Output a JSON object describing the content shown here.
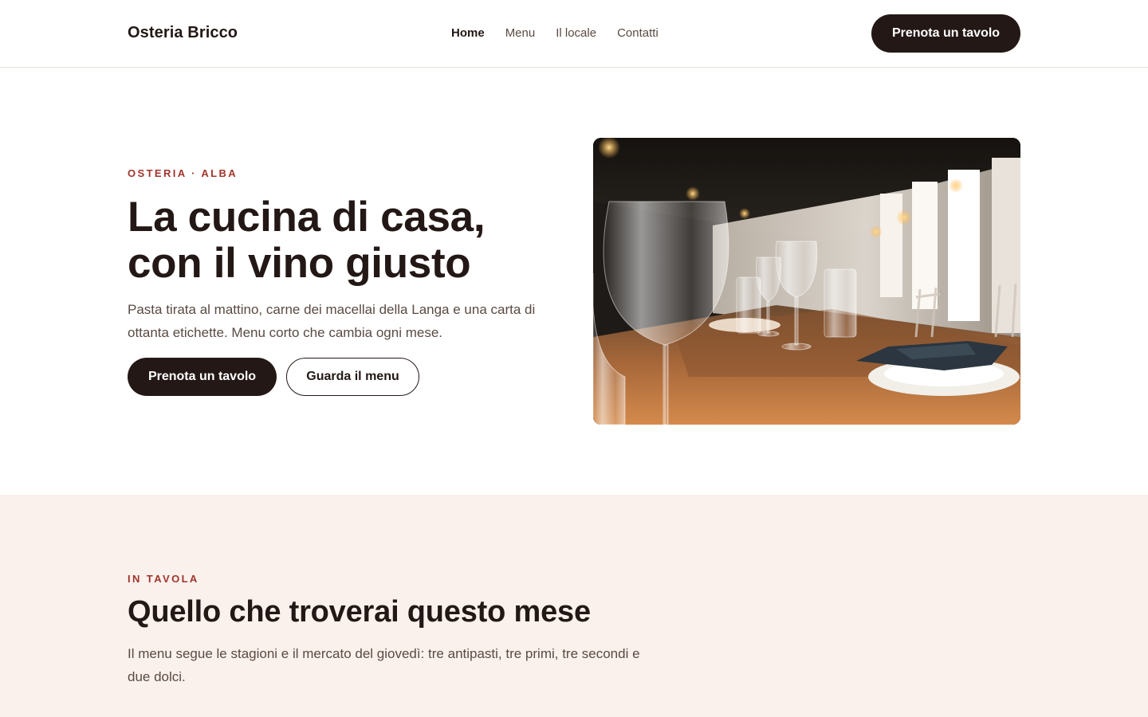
{
  "header": {
    "brand": "Osteria Bricco",
    "nav": [
      {
        "label": "Home",
        "active": true
      },
      {
        "label": "Menu",
        "active": false
      },
      {
        "label": "Il locale",
        "active": false
      },
      {
        "label": "Contatti",
        "active": false
      }
    ],
    "cta_label": "Prenota un tavolo"
  },
  "hero": {
    "eyebrow": "OSTERIA · ALBA",
    "title_line1": "La cucina di casa,",
    "title_line2": "con il vino giusto",
    "lead": "Pasta tirata al mattino, carne dei macellai della Langa e una carta di ottanta etichette. Menu corto che cambia ogni mese.",
    "primary_button": "Prenota un tavolo",
    "secondary_button": "Guarda il menu",
    "image_icon": "restaurant-photo"
  },
  "menu_intro": {
    "eyebrow": "IN TAVOLA",
    "title": "Quello che troverai questo mese",
    "lead": "Il menu segue le stagioni e il mercato del giovedì: tre antipasti, tre primi, tre secondi e due dolci."
  },
  "colors": {
    "dark": "#231815",
    "accent": "#a0352b",
    "muted_text": "#5a4a43",
    "section_bg": "#faf1ec"
  }
}
